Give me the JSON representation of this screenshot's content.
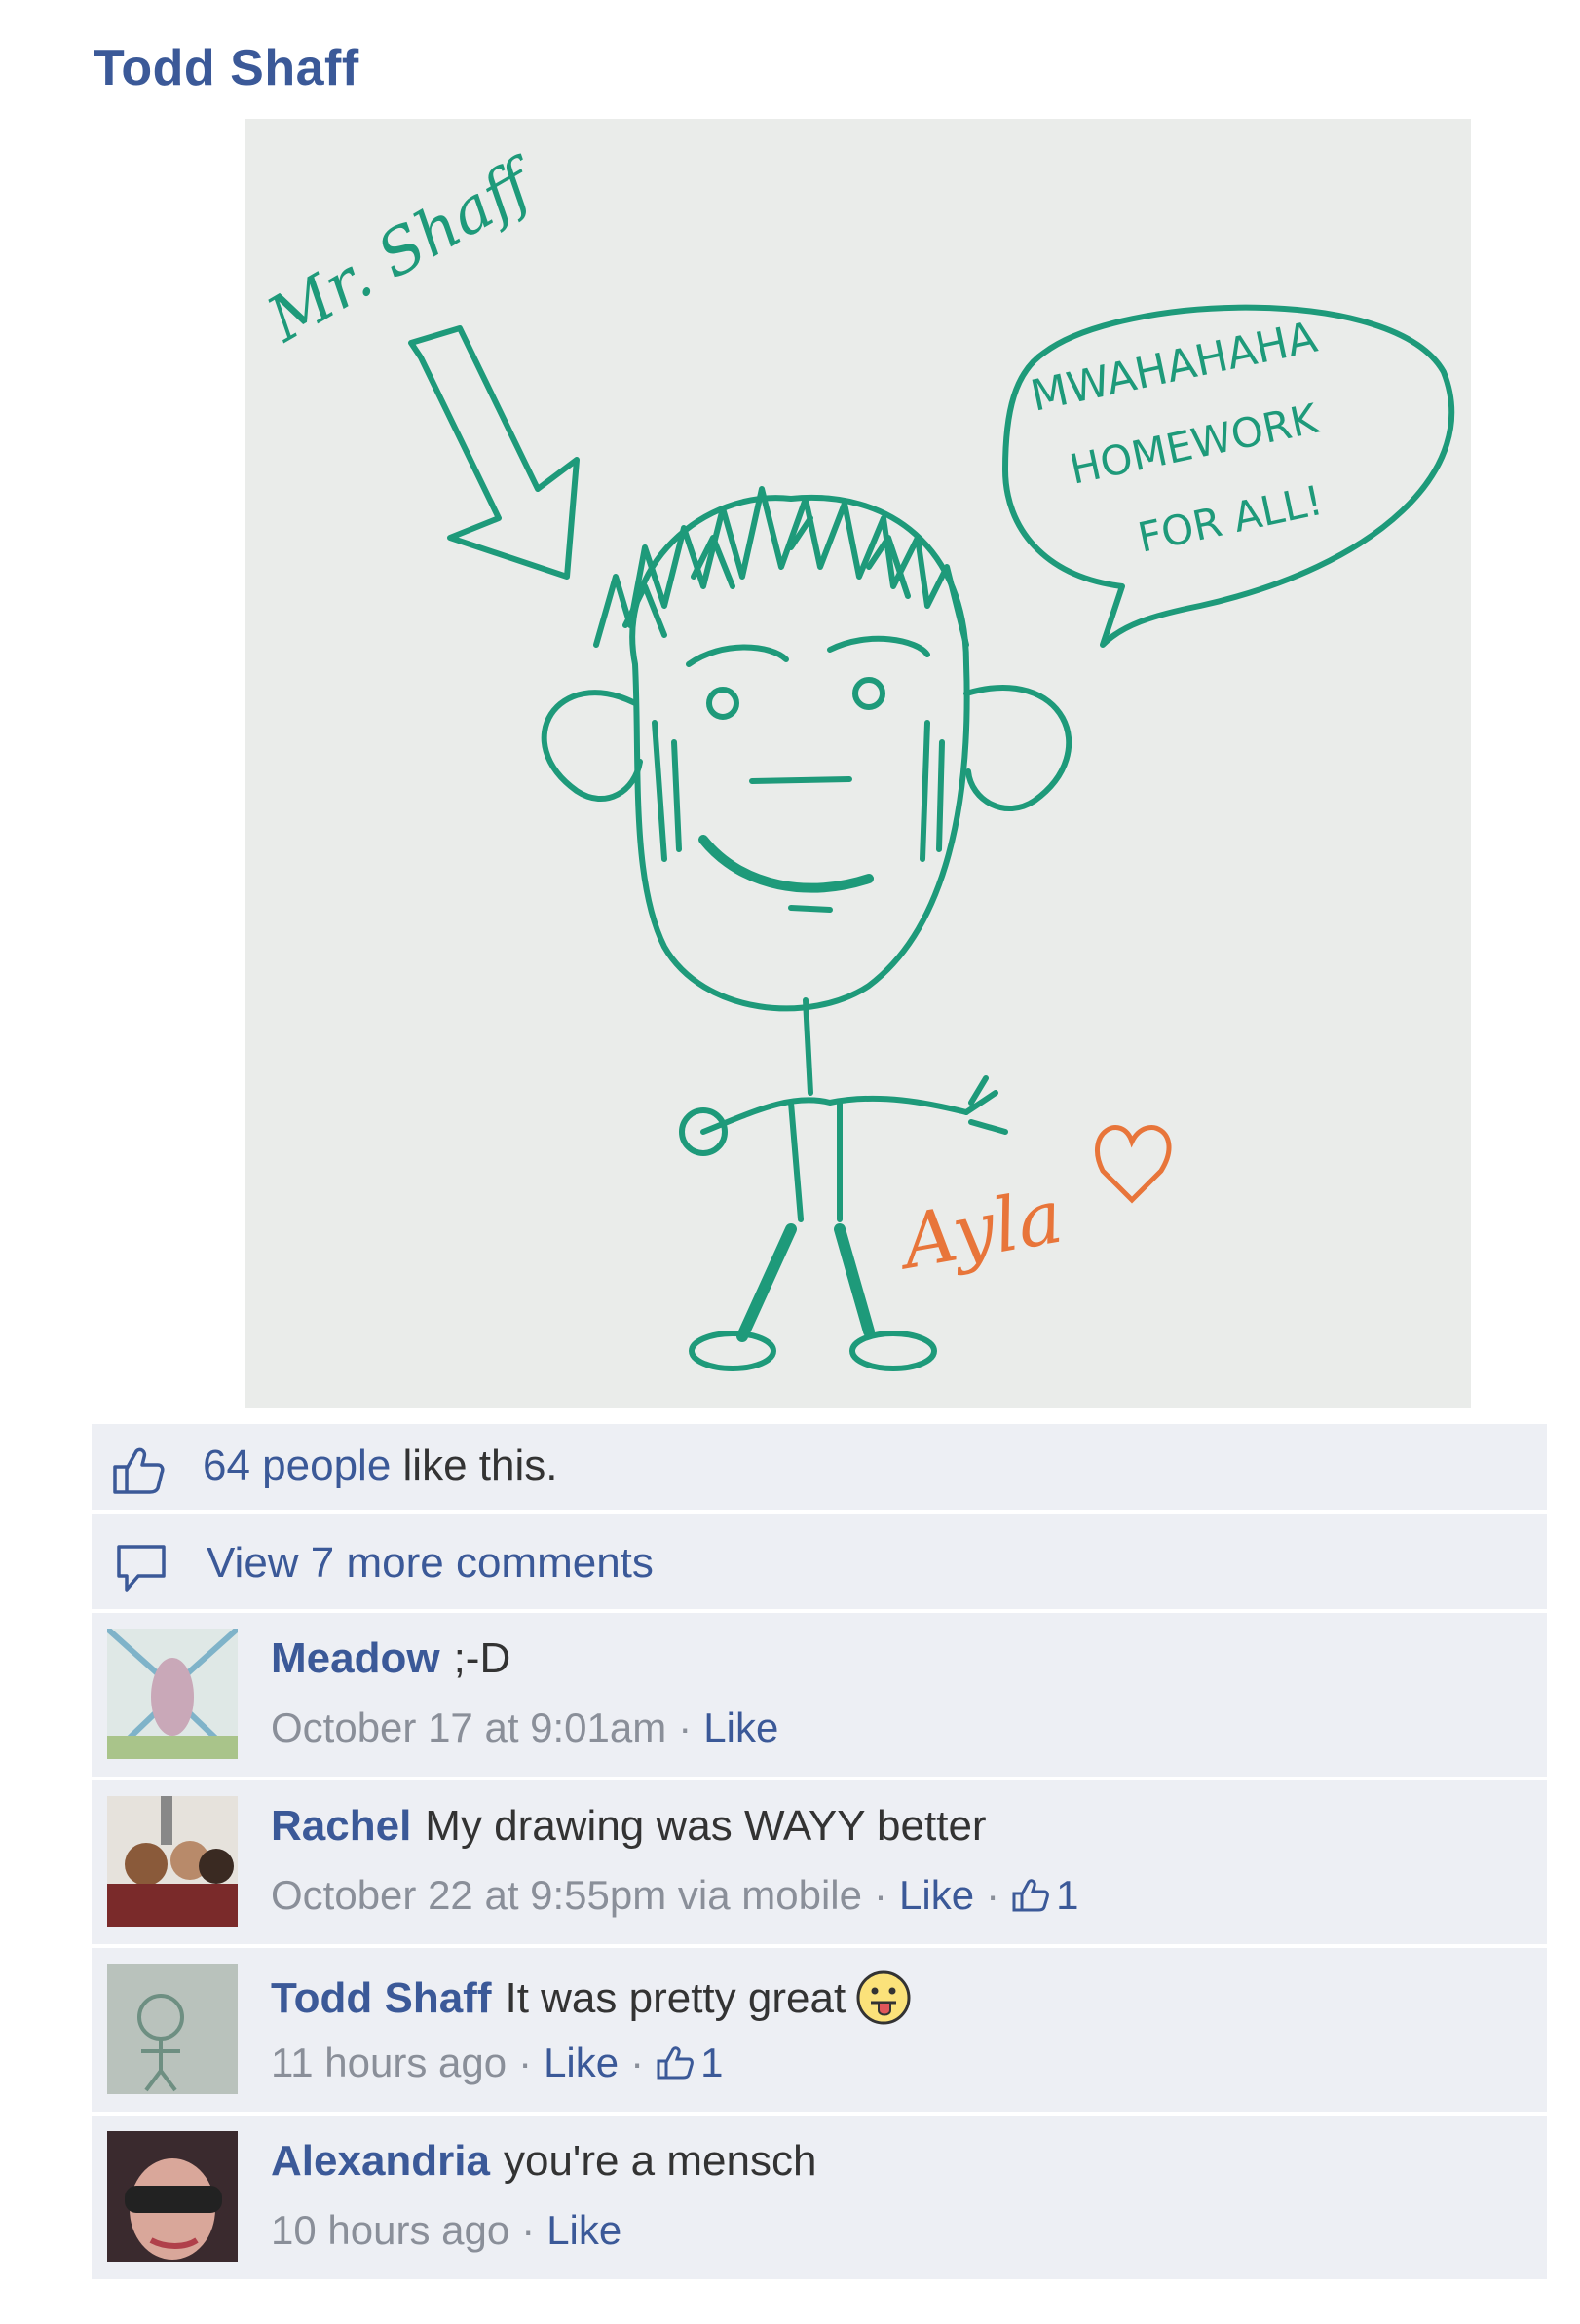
{
  "post": {
    "author": "Todd Shaff",
    "photo_text": {
      "label_top": "Mr. Shaff",
      "speech_line1": "MWAHAHAHA",
      "speech_line2": "HOMEWORK",
      "speech_line3": "FOR ALL!",
      "signature": "Ayla"
    }
  },
  "likes": {
    "count_text": "64 people",
    "suffix": "like this."
  },
  "view_more": "View 7 more comments",
  "comments": [
    {
      "name": "Meadow",
      "text": ";-D",
      "time": "October 17 at 9:01am",
      "like_label": "Like",
      "like_count": ""
    },
    {
      "name": "Rachel",
      "text": "My drawing was WAYY better",
      "time": "October 22 at 9:55pm via mobile",
      "like_label": "Like",
      "like_count": "1"
    },
    {
      "name": "Todd Shaff",
      "text": "It was pretty great",
      "time": "11 hours ago",
      "like_label": "Like",
      "like_count": "1"
    },
    {
      "name": "Alexandria",
      "text": "you're a mensch",
      "time": "10 hours ago",
      "like_label": "Like",
      "like_count": ""
    }
  ],
  "colors": {
    "link": "#3b5998",
    "row_bg": "#edeff4",
    "marker_green": "#1e9a7a",
    "signature_orange": "#e8753a"
  }
}
